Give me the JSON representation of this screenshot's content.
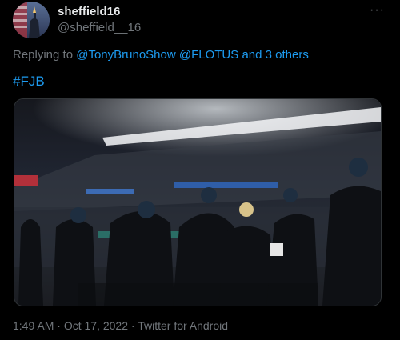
{
  "tweet": {
    "display_name": "sheffield16",
    "handle": "@sheffield__16",
    "more_label": "···",
    "reply": {
      "prefix": "Replying to",
      "mention_1": "@TonyBrunoShow",
      "mention_2": "@FLOTUS",
      "others": "and 3 others"
    },
    "hashtag": "#FJB",
    "meta": {
      "time": "1:49 AM",
      "separator": "·",
      "date": "Oct 17, 2022",
      "source": "Twitter for Android"
    }
  },
  "icons": {
    "avatar": "statue-of-liberty-avatar",
    "media": "stadium-photo"
  },
  "colors": {
    "background": "#000000",
    "text": "#e7e9ea",
    "secondary": "#71767b",
    "link": "#1d9bf0"
  }
}
